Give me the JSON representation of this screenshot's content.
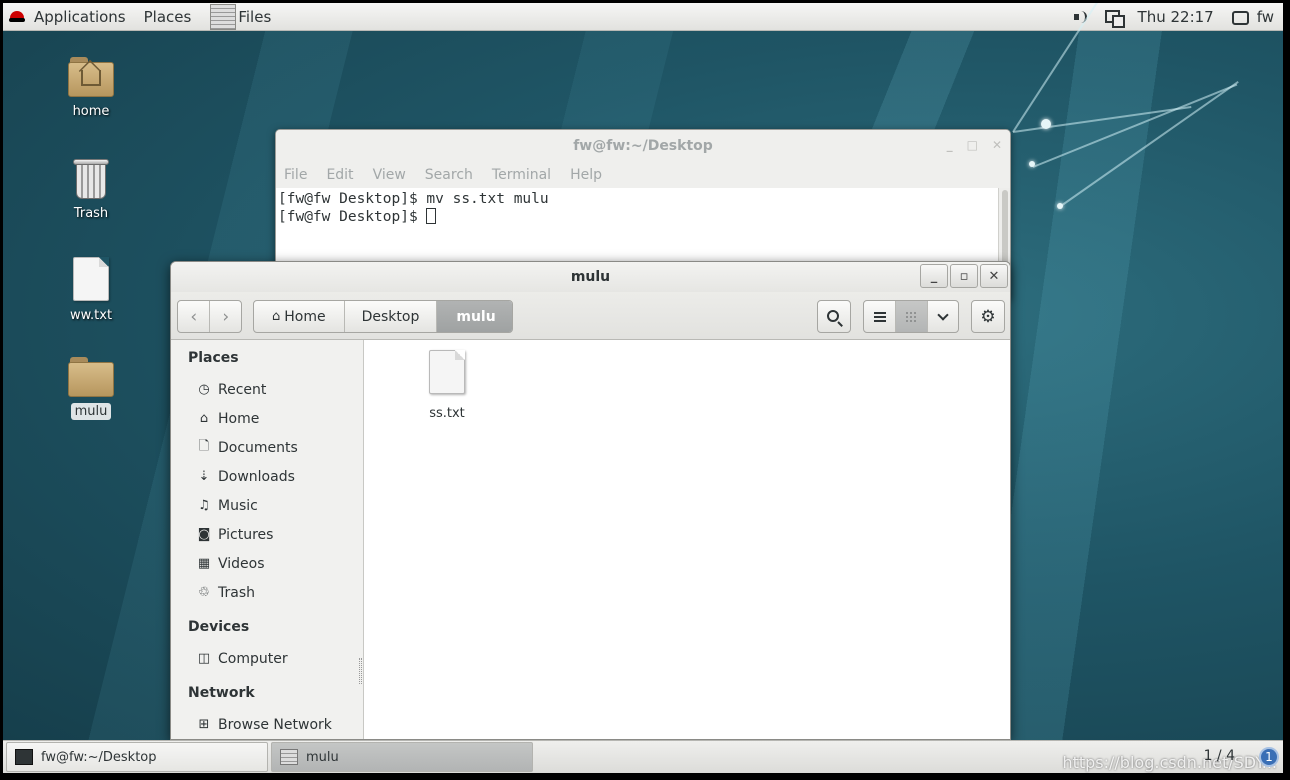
{
  "topbar": {
    "applications": "Applications",
    "places": "Places",
    "files": "Files",
    "clock": "Thu 22:17",
    "user": "fw"
  },
  "desktop_icons": [
    {
      "label": "home",
      "icon": "home-folder-icon"
    },
    {
      "label": "Trash",
      "icon": "trash-icon"
    },
    {
      "label": "ww.txt",
      "icon": "text-file-icon"
    },
    {
      "label": "mulu",
      "icon": "folder-icon"
    }
  ],
  "terminal": {
    "title": "fw@fw:~/Desktop",
    "menu": [
      "File",
      "Edit",
      "View",
      "Search",
      "Terminal",
      "Help"
    ],
    "lines": [
      "[fw@fw Desktop]$ mv ss.txt mulu",
      "[fw@fw Desktop]$ "
    ]
  },
  "files_window": {
    "title": "mulu",
    "breadcrumb": [
      "Home",
      "Desktop",
      "mulu"
    ],
    "sidebar": {
      "places_heading": "Places",
      "places": [
        "Recent",
        "Home",
        "Documents",
        "Downloads",
        "Music",
        "Pictures",
        "Videos",
        "Trash"
      ],
      "devices_heading": "Devices",
      "devices": [
        "Computer"
      ],
      "network_heading": "Network",
      "network": [
        "Browse Network"
      ]
    },
    "files": [
      "ss.txt"
    ]
  },
  "taskbar": {
    "tasks": [
      "fw@fw:~/Desktop",
      "mulu"
    ],
    "pager": "1 / 4",
    "notification": "1",
    "watermark": "https://blog.csdn.net/SDY..."
  }
}
